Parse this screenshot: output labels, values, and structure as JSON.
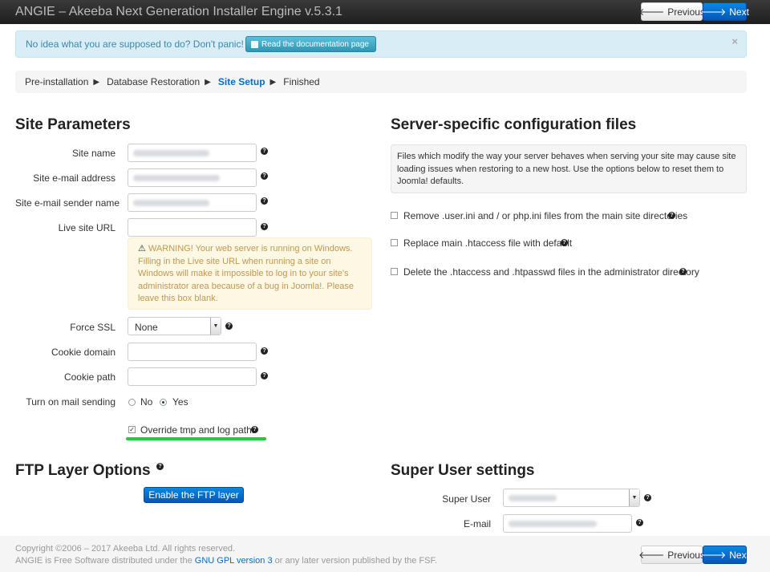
{
  "header": {
    "title": "ANGIE – Akeeba Next Generation Installer Engine v.5.3.1",
    "previous_label": "Previous",
    "next_label": "Next"
  },
  "alert": {
    "text": "No idea what you are supposed to do? Don't panic!",
    "doc_button": "Read the documentation page",
    "close": "×"
  },
  "breadcrumb": [
    "Pre-installation",
    "Database Restoration",
    "Site Setup",
    "Finished"
  ],
  "site_params": {
    "heading": "Site Parameters",
    "site_name_label": "Site name",
    "site_email_label": "Site e-mail address",
    "sender_name_label": "Site e-mail sender name",
    "live_url_label": "Live site URL",
    "warning": "WARNING! Your web server is running on Windows. Filling in the Live site URL when running a site on Windows will make it impossible to log in to your site's administrator area because of a bug in Joomla!. Please leave this box blank.",
    "force_ssl_label": "Force SSL",
    "force_ssl_value": "None",
    "cookie_domain_label": "Cookie domain",
    "cookie_path_label": "Cookie path",
    "mail_label": "Turn on mail sending",
    "mail_no": "No",
    "mail_yes": "Yes",
    "override_label": "Override tmp and log paths"
  },
  "server_config": {
    "heading": "Server-specific configuration files",
    "info": "Files which modify the way your server behaves when serving your site may cause site loading issues when restoring to a new host. Use the options below to reset them to Joomla! defaults.",
    "opt1": "Remove .user.ini and / or php.ini files from the main site directories",
    "opt2": "Replace main .htaccess file with default",
    "opt3": "Delete the .htaccess and .htpasswd files in the administrator directory"
  },
  "ftp": {
    "heading": "FTP Layer Options",
    "button": "Enable the FTP layer"
  },
  "super_user": {
    "heading": "Super User settings",
    "user_label": "Super User",
    "email_label": "E-mail"
  },
  "footer": {
    "copyright": "Copyright ©2006 – 2017 Akeeba Ltd. All rights reserved.",
    "license_prefix": "ANGIE is Free Software distributed under the",
    "license_link": "GNU GPL version 3",
    "license_suffix": "or any later version published by the FSF."
  },
  "icons": {
    "help": "question-circle-icon",
    "warning": "warning-triangle-icon",
    "prev": "arrow-left-icon",
    "next": "arrow-right-icon"
  }
}
